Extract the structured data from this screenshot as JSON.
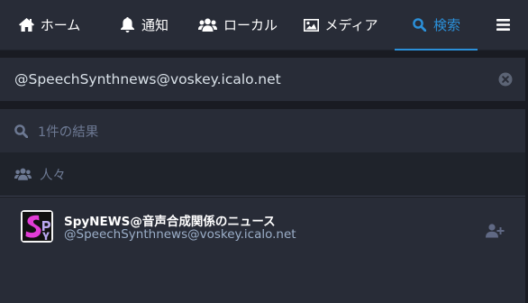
{
  "tabs": [
    {
      "label": "ホーム",
      "icon": "home-icon"
    },
    {
      "label": "通知",
      "icon": "bell-icon"
    },
    {
      "label": "ローカル",
      "icon": "users-icon"
    },
    {
      "label": "メディア",
      "icon": "image-icon"
    },
    {
      "label": "検索",
      "icon": "search-icon",
      "active": true
    },
    {
      "label": "",
      "icon": "menu-icon"
    }
  ],
  "search": {
    "value": "@SpeechSynthnews@voskey.icalo.net"
  },
  "results": {
    "count_label": "1件の結果",
    "section_label": "人々"
  },
  "account": {
    "display_name": "SpyNEWS@音声合成関係のニュース",
    "handle": "@SpeechSynthnews@voskey.icalo.net"
  },
  "colors": {
    "accent": "#2b90d9",
    "panel": "#282c37",
    "background": "#191b22",
    "muted": "#6d7993"
  }
}
